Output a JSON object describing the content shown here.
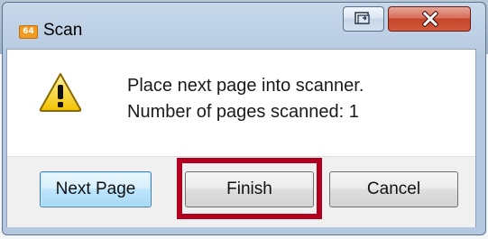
{
  "window": {
    "title": "Scan",
    "app_icon_text": "64",
    "title_buttons": [
      {
        "name": "restore",
        "icon": "restore-icon"
      },
      {
        "name": "close",
        "icon": "close-icon",
        "color": "#c4452b"
      }
    ]
  },
  "dialog": {
    "icon": "warning-icon",
    "message_line1": "Place next page into scanner.",
    "message_line2": "Number of pages scanned: 1"
  },
  "buttons": {
    "next_page": "Next Page",
    "finish": "Finish",
    "cancel": "Cancel"
  },
  "annotation": {
    "highlight_color": "#b3001e",
    "target": "Finish"
  }
}
